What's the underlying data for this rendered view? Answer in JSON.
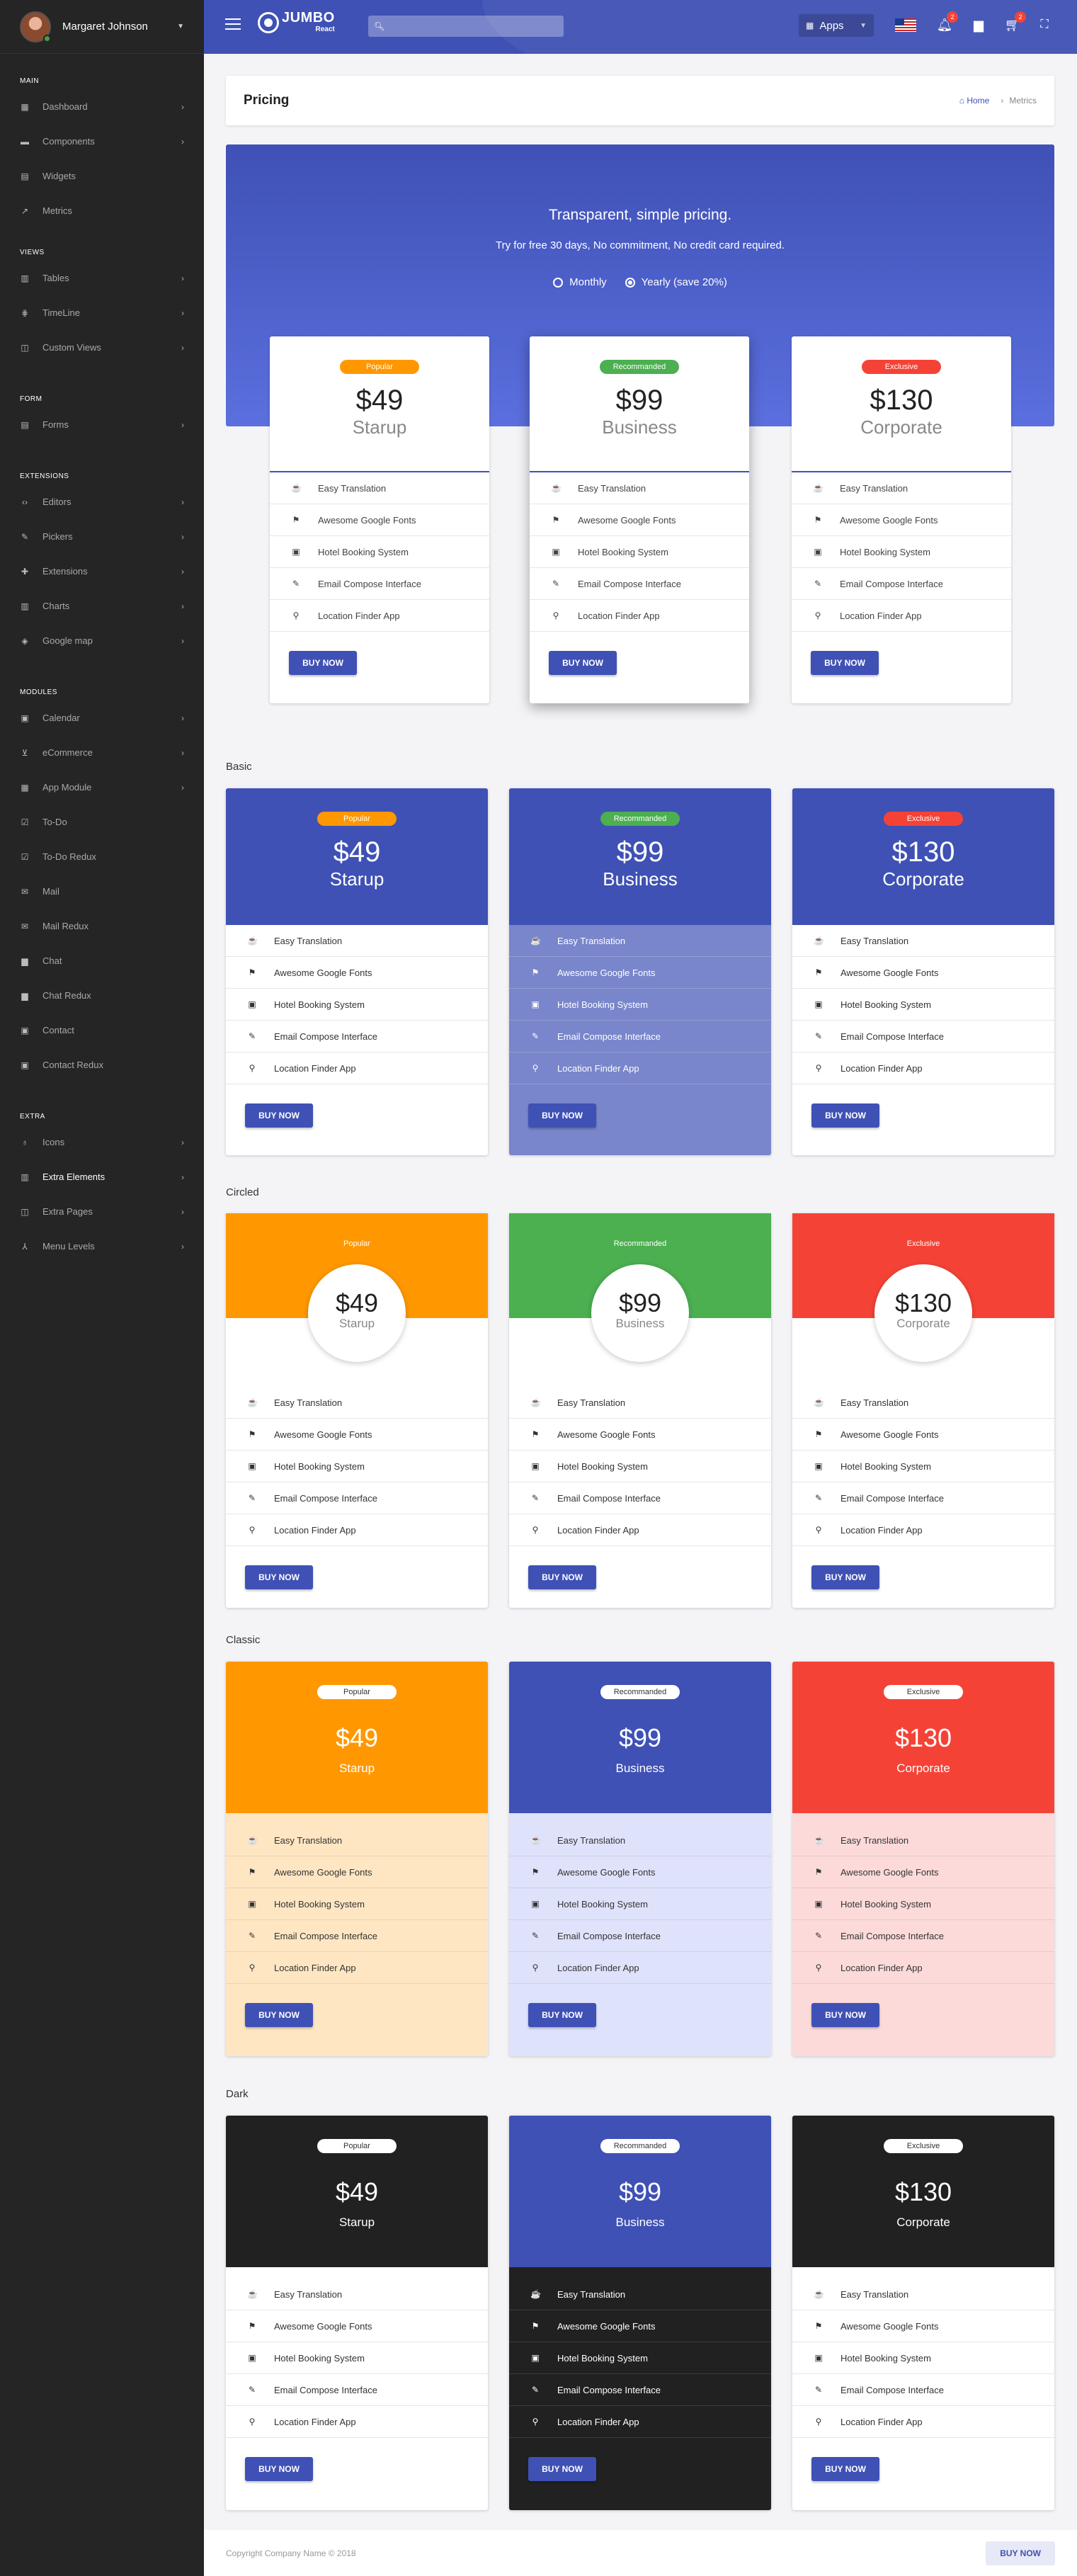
{
  "user": {
    "name": "Margaret Johnson"
  },
  "sidebar": {
    "sections": [
      {
        "title": "Main",
        "items": [
          {
            "label": "Dashboard",
            "icon": "dashboard-icon",
            "chev": true
          },
          {
            "label": "Components",
            "icon": "folder-icon",
            "chev": true
          },
          {
            "label": "Widgets",
            "icon": "widgets-icon",
            "chev": false
          },
          {
            "label": "Metrics",
            "icon": "trending-icon",
            "chev": false
          }
        ]
      },
      {
        "title": "Views",
        "items": [
          {
            "label": "Tables",
            "icon": "table-icon",
            "chev": true
          },
          {
            "label": "TimeLine",
            "icon": "timeline-icon",
            "chev": true
          },
          {
            "label": "Custom Views",
            "icon": "views-icon",
            "chev": true
          }
        ]
      },
      {
        "title": "Form",
        "items": [
          {
            "label": "Forms",
            "icon": "forms-icon",
            "chev": true
          }
        ]
      },
      {
        "title": "Extensions",
        "items": [
          {
            "label": "Editors",
            "icon": "code-icon",
            "chev": true
          },
          {
            "label": "Pickers",
            "icon": "picker-icon",
            "chev": true
          },
          {
            "label": "Extensions",
            "icon": "puzzle-icon",
            "chev": true
          },
          {
            "label": "Charts",
            "icon": "chart-icon",
            "chev": true
          },
          {
            "label": "Google map",
            "icon": "map-icon",
            "chev": true
          }
        ]
      },
      {
        "title": "Modules",
        "items": [
          {
            "label": "Calendar",
            "icon": "calendar-icon",
            "chev": true
          },
          {
            "label": "eCommerce",
            "icon": "cart-icon",
            "chev": true
          },
          {
            "label": "App Module",
            "icon": "module-icon",
            "chev": true
          },
          {
            "label": "To-Do",
            "icon": "check-icon",
            "chev": false
          },
          {
            "label": "To-Do Redux",
            "icon": "check-icon",
            "chev": false
          },
          {
            "label": "Mail",
            "icon": "mail-icon",
            "chev": false
          },
          {
            "label": "Mail Redux",
            "icon": "mail-icon",
            "chev": false
          },
          {
            "label": "Chat",
            "icon": "chat-icon",
            "chev": false
          },
          {
            "label": "Chat Redux",
            "icon": "chat-icon",
            "chev": false
          },
          {
            "label": "Contact",
            "icon": "contact-icon",
            "chev": false
          },
          {
            "label": "Contact Redux",
            "icon": "contact-icon",
            "chev": false
          }
        ]
      },
      {
        "title": "Extra",
        "items": [
          {
            "label": "Icons",
            "icon": "icons-icon",
            "chev": true
          },
          {
            "label": "Extra Elements",
            "icon": "elements-icon",
            "chev": true,
            "active": true
          },
          {
            "label": "Extra Pages",
            "icon": "pages-icon",
            "chev": true
          },
          {
            "label": "Menu Levels",
            "icon": "levels-icon",
            "chev": true
          }
        ]
      }
    ]
  },
  "header": {
    "logo": "JUMBO",
    "logo_sub": "React",
    "search_placeholder": "",
    "apps_label": "Apps",
    "notifications_count": "2",
    "cart_count": "2"
  },
  "page": {
    "title": "Pricing",
    "breadcrumb_home": "Home",
    "breadcrumb_current": "Metrics"
  },
  "hero": {
    "title": "Transparent, simple pricing.",
    "subtitle": "Try for free 30 days, No commitment, No credit card required.",
    "option_monthly": "Monthly",
    "option_yearly": "Yearly (save 20%)",
    "selected": "yearly"
  },
  "plans": [
    {
      "badge": "Popular",
      "price": "$49",
      "name": "Starup"
    },
    {
      "badge": "Recommanded",
      "price": "$99",
      "name": "Business"
    },
    {
      "badge": "Exclusive",
      "price": "$130",
      "name": "Corporate"
    }
  ],
  "features": [
    {
      "label": "Easy Translation",
      "icon": "cup-icon",
      "glyph": "☕"
    },
    {
      "label": "Awesome Google Fonts",
      "icon": "flag-icon",
      "glyph": "⚑"
    },
    {
      "label": "Hotel Booking System",
      "icon": "calendar-icon",
      "glyph": "▣"
    },
    {
      "label": "Email Compose Interface",
      "icon": "pencil-icon",
      "glyph": "✎"
    },
    {
      "label": "Location Finder App",
      "icon": "location-icon",
      "glyph": "⚲"
    }
  ],
  "buy_label": "BUY NOW",
  "sections": {
    "basic": "Basic",
    "circled": "Circled",
    "classic": "Classic",
    "dark": "Dark"
  },
  "colors": {
    "primary": "#3f51b5",
    "popular": "#ff9800",
    "recommended": "#4caf50",
    "exclusive": "#f44336",
    "dark": "#212121",
    "classic_popular_bg": "#ffe6c2",
    "classic_business_bg": "#dfe2fb",
    "classic_corporate_bg": "#fcdada"
  },
  "footer": {
    "copyright": "Copyright Company Name © 2018",
    "buy_label": "BUY NOW"
  }
}
